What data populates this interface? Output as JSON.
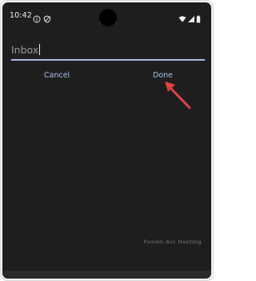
{
  "status_bar": {
    "time": "10:42",
    "left_icons": [
      "info-icon",
      "shield-icon"
    ],
    "right_icons": [
      "wifi-icon",
      "signal-icon",
      "battery-icon"
    ]
  },
  "text_field": {
    "value": "Inbox"
  },
  "actions": {
    "cancel_label": "Cancel",
    "done_label": "Done"
  },
  "annotation": {
    "arrow_color": "#e04343",
    "points_to": "done-button"
  },
  "watermark": {
    "text": "Fusion Arc Hosting"
  },
  "colors": {
    "background": "#1e1e1e",
    "accent": "#a9c1ef",
    "underline": "#a9bde6"
  }
}
